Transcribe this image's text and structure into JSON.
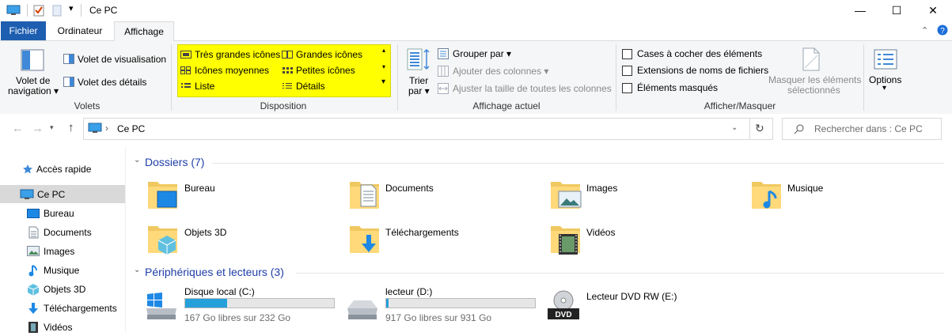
{
  "window": {
    "title": "Ce PC",
    "buttons": {
      "minimize": "—",
      "maximize": "☐",
      "close": "✕"
    }
  },
  "tabs": [
    "Fichier",
    "Ordinateur",
    "Affichage"
  ],
  "ribbon": {
    "volets": {
      "group_label": "Volets",
      "volet_navigation": "Volet de\nnavigation",
      "volet_navigation_l1": "Volet de",
      "volet_navigation_l2": "navigation ▾",
      "volet_visualisation": "Volet de visualisation",
      "volet_details": "Volet des détails"
    },
    "disposition": {
      "group_label": "Disposition",
      "items": [
        "Très grandes icônes",
        "Grandes icônes",
        "Icônes moyennes",
        "Petites icônes",
        "Liste",
        "Détails"
      ]
    },
    "affichage_actuel": {
      "group_label": "Affichage actuel",
      "trier_l1": "Trier",
      "trier_l2": "par ▾",
      "grouper": "Grouper par ▾",
      "ajouter": "Ajouter des colonnes ▾",
      "ajuster": "Ajuster la taille de toutes les colonnes"
    },
    "afficher_masquer": {
      "group_label": "Afficher/Masquer",
      "cases": "Cases à cocher des éléments",
      "extensions": "Extensions de noms de fichiers",
      "masques": "Éléments masqués",
      "masquer_l1": "Masquer les éléments",
      "masquer_l2": "sélectionnés"
    },
    "options": {
      "label": "Options",
      "arrow": "▾"
    }
  },
  "address": {
    "path": "Ce PC",
    "separator": "›",
    "search_placeholder": "Rechercher dans : Ce PC"
  },
  "nav": {
    "items": [
      {
        "label": "Accès rapide"
      },
      {
        "label": "Ce PC"
      },
      {
        "label": "Bureau"
      },
      {
        "label": "Documents"
      },
      {
        "label": "Images"
      },
      {
        "label": "Musique"
      },
      {
        "label": "Objets 3D"
      },
      {
        "label": "Téléchargements"
      },
      {
        "label": "Vidéos"
      }
    ]
  },
  "content": {
    "folders_header": "Dossiers (7)",
    "folders": [
      "Bureau",
      "Documents",
      "Images",
      "Musique",
      "Objets 3D",
      "Téléchargements",
      "Vidéos"
    ],
    "drives_header": "Périphériques et lecteurs (3)",
    "drives": [
      {
        "name": "Disque local (C:)",
        "free": "167 Go libres sur 232 Go",
        "used_fraction": 0.28
      },
      {
        "name": "lecteur (D:)",
        "free": "917 Go libres sur 931 Go",
        "used_fraction": 0.015
      },
      {
        "name": "Lecteur DVD RW (E:)"
      }
    ],
    "dvd_label": "DVD"
  },
  "colors": {
    "accent": "#1e5eb0",
    "highlight": "#ffff00",
    "bar_fill": "#26a0da",
    "selection": "#d9d9d9"
  }
}
